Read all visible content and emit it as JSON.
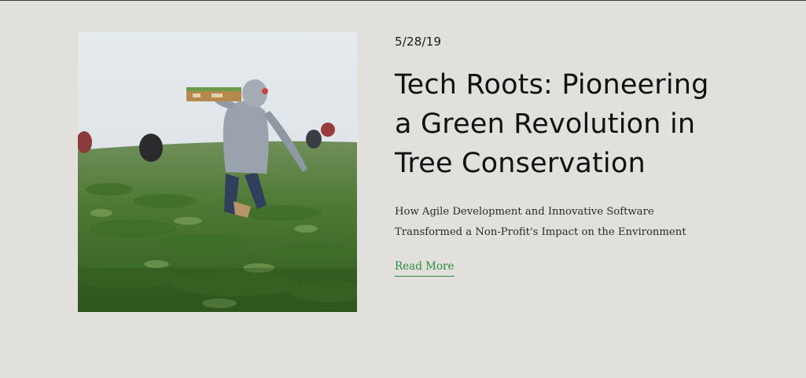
{
  "post": {
    "date": "5/28/19",
    "title": "Tech Roots: Pioneering a Green Revolution in Tree Conservation",
    "excerpt": "How Agile Development and Innovative Software Transformed a Non-Profit's Impact on the Environment",
    "read_more": "Read More"
  },
  "colors": {
    "background": "#e1e0dc",
    "link": "#2e8b3d",
    "title": "#111111"
  }
}
